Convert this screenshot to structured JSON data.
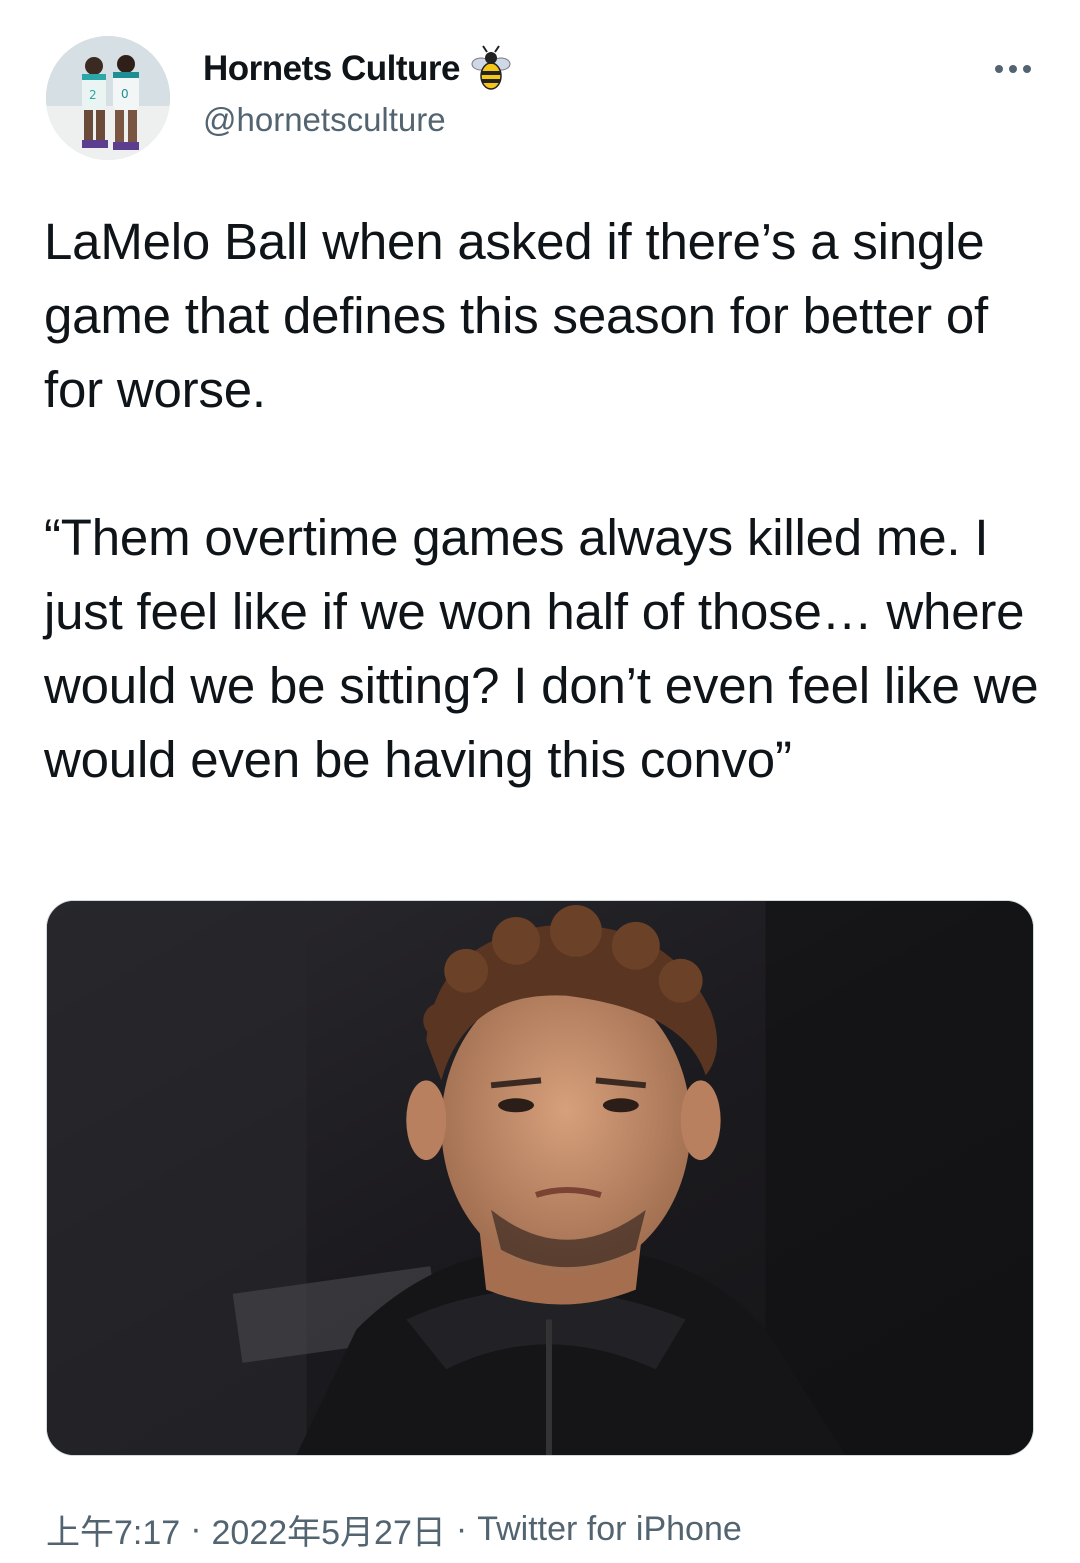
{
  "tweet": {
    "author": {
      "display_name": "Hornets Culture",
      "handle": "@hornetsculture",
      "badge_icon": "bee-icon",
      "avatar_icon": "avatar-players-image"
    },
    "more_icon": "more-options-icon",
    "text": "LaMelo Ball when asked if there’s a single game that defines this season for better of for worse.\n\n“Them overtime games always killed me. I just feel like if we won half of those… where would we be sitting? I don’t even feel like we would even be having this convo”",
    "media_icon": "player-photo",
    "time": "上午7:17",
    "separator": "·",
    "date": "2022年5月27日",
    "source": "Twitter for iPhone"
  },
  "colors": {
    "text": "#0f1419",
    "secondary": "#536471",
    "background": "#ffffff"
  }
}
